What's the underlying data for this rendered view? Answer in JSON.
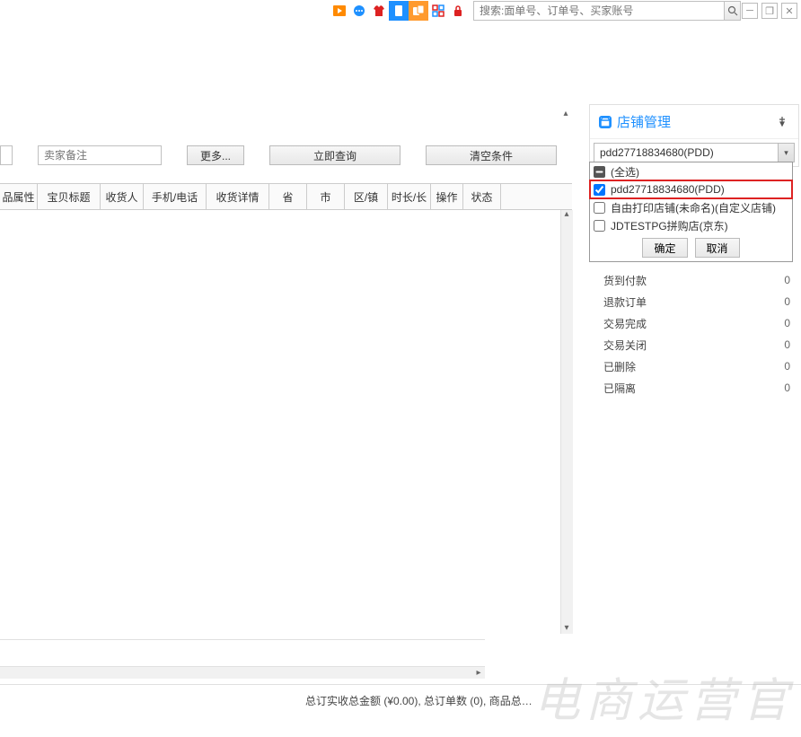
{
  "toolbar": {
    "icons": {
      "play": "play-icon",
      "message": "message-icon",
      "shirt": "shirt-icon",
      "phone1": "phone-icon",
      "phone2": "screens-icon",
      "qr": "qr-icon",
      "lock": "lock-icon"
    }
  },
  "search": {
    "placeholder": "搜索:面单号、订单号、买家账号"
  },
  "filter": {
    "note_placeholder": "卖家备注",
    "more_label": "更多...",
    "query_label": "立即查询",
    "clear_label": "清空条件"
  },
  "table": {
    "headers": [
      "品属性",
      "宝贝标题",
      "收货人",
      "手机/电话",
      "收货详情",
      "省",
      "市",
      "区/镇",
      "时长/长",
      "操作",
      "状态"
    ]
  },
  "rpanel": {
    "title": "店铺管理",
    "selected": "pdd27718834680(PDD)",
    "options": {
      "select_all": "(全选)",
      "opt1": "pdd27718834680(PDD)",
      "opt2": "自由打印店铺(未命名)(自定义店铺)",
      "opt3": "JDTESTPG拼购店(京东)"
    },
    "confirm": "确定",
    "cancel": "取消"
  },
  "stats": {
    "rows": [
      {
        "label": "货到付款",
        "value": "0"
      },
      {
        "label": "退款订单",
        "value": "0"
      },
      {
        "label": "交易完成",
        "value": "0"
      },
      {
        "label": "交易关闭",
        "value": "0"
      },
      {
        "label": "已删除",
        "value": "0"
      },
      {
        "label": "已隔离",
        "value": "0"
      }
    ]
  },
  "footer": {
    "summary": "总订实收总金额 (¥0.00),  总订单数 (0),  商品总…"
  },
  "watermark": "电商运营官"
}
